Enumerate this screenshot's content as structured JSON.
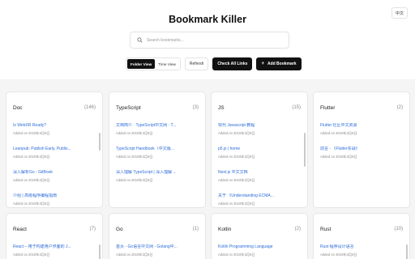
{
  "lang_toggle": "中文",
  "app_title": "Bookmark Killer",
  "search": {
    "placeholder": "Search bookmarks..."
  },
  "toolbar": {
    "folder_view": "Folder View",
    "time_view": "Time View",
    "refresh": "Refresh",
    "check_links": "Check All Links",
    "add_bookmark": "Add Bookmark",
    "add_icon": "+"
  },
  "cards": [
    {
      "name": "Doc",
      "count": "(146)",
      "items": [
        {
          "title": "Is WebXR Ready?",
          "date": "Added on 2019年3月8日"
        },
        {
          "title": "Leanpub: Publish Early, Publis...",
          "date": "Added on 2019年3月8日"
        },
        {
          "title": "深入解析Go - GitBook",
          "date": "Added on 2019年3月8日"
        },
        {
          "title": "介绍 | 高级程序编程指南",
          "date": "Added on 2019年3月8日"
        }
      ]
    },
    {
      "name": "TypeScript",
      "count": "(3)",
      "items": [
        {
          "title": "文档简介 · TypeScript中文网 · T...",
          "date": "Added on 2019年3月8日"
        },
        {
          "title": "TypeScript Handbook（中文版...",
          "date": "Added on 2019年3月8日"
        },
        {
          "title": "深入理解 TypeScript | 深入理解 ...",
          "date": "Added on 2019年3月8日"
        }
      ]
    },
    {
      "name": "JS",
      "count": "(15)",
      "items": [
        {
          "title": "现代 Javascript 教程",
          "date": "Added on 2019年3月8日"
        },
        {
          "title": "p5.js | home",
          "date": "Added on 2019年3月8日"
        },
        {
          "title": "Next.js 中文文档",
          "date": "Added on 2019年3月8日"
        },
        {
          "title": "关于 《Understanding ECMA...",
          "date": "Added on 2019年3月8日"
        }
      ]
    },
    {
      "name": "Flutter",
      "count": "(2)",
      "items": [
        {
          "title": "Flutter 社区中文资源",
          "date": "Added on 2019年3月8日"
        },
        {
          "title": "前言 - 《Flutter实战》",
          "date": "Added on 2019年3月8日"
        }
      ]
    },
    {
      "name": "React",
      "count": "(7)",
      "items": [
        {
          "title": "React – 用于构建用户界面的 J...",
          "date": "Added on 2019年3月8日"
        }
      ]
    },
    {
      "name": "Go",
      "count": "(1)",
      "items": [
        {
          "title": "首页 - Go语言中文网 - Golang中...",
          "date": "Added on 2019年3月8日"
        }
      ]
    },
    {
      "name": "Kotlin",
      "count": "(2)",
      "items": [
        {
          "title": "Kotlin Programming Language",
          "date": "Added on 2019年3月8日"
        }
      ]
    },
    {
      "name": "Rust",
      "count": "(10)",
      "items": [
        {
          "title": "Rust 程序设计语言",
          "date": "Added on 2019年3月8日"
        }
      ]
    }
  ],
  "colors": {
    "link": "#2b6cd8",
    "accent": "#111111",
    "background": "#f5f5f5"
  }
}
